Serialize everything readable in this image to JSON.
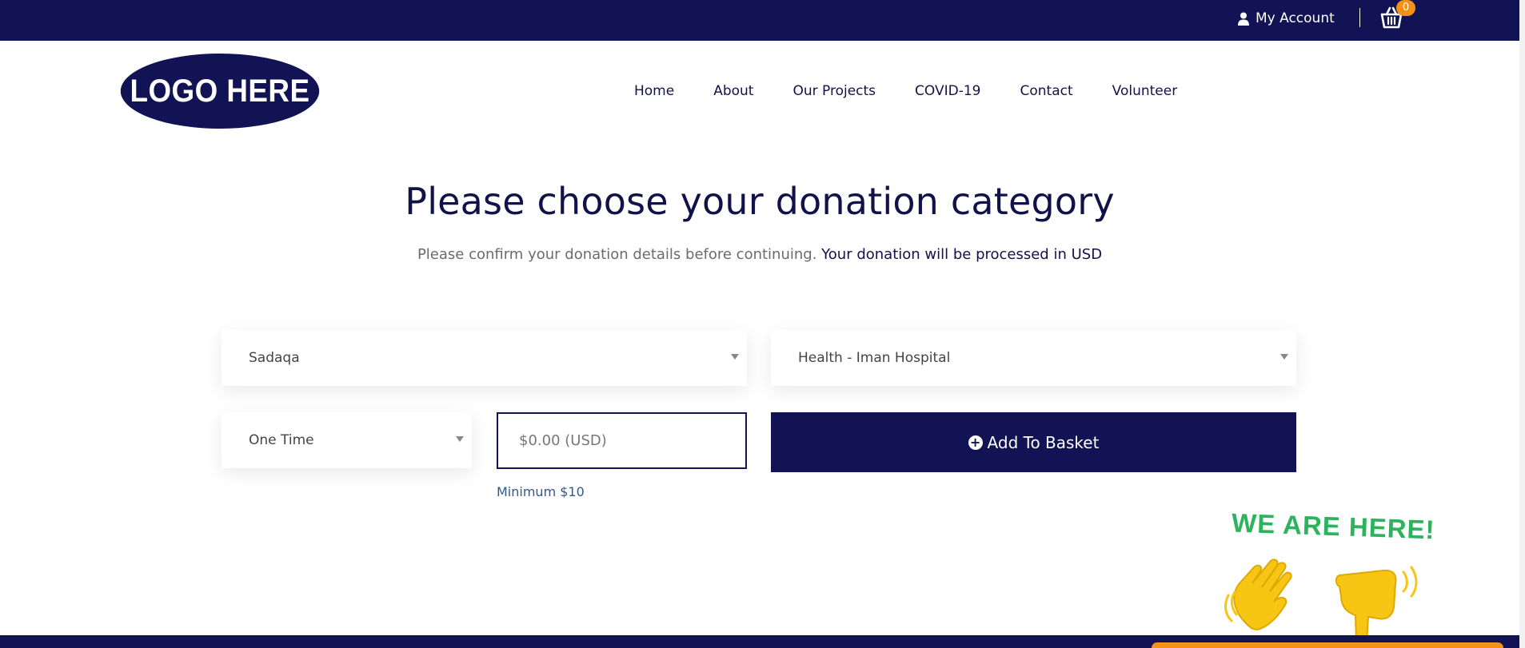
{
  "topbar": {
    "account_label": "My Account",
    "cart_count": "0"
  },
  "logo": {
    "text": "LOGO HERE"
  },
  "nav": {
    "items": [
      "Home",
      "About",
      "Our Projects",
      "COVID-19",
      "Contact",
      "Volunteer"
    ]
  },
  "main": {
    "title": "Please choose your donation category",
    "subtitle": "Please confirm your donation details before continuing.",
    "subtitle_emphasis": "Your donation will be processed in USD"
  },
  "form": {
    "category": "Sadaqa",
    "project": "Health - Iman Hospital",
    "frequency": "One Time",
    "amount_placeholder": "$0.00 (USD)",
    "minimum_note": "Minimum $10",
    "add_button_label": "Add To Basket"
  },
  "widget": {
    "text": "WE ARE HERE!"
  },
  "colors": {
    "brand_navy": "#111354",
    "accent_orange": "#f39214",
    "widget_green": "#2db35d",
    "emoji_yellow": "#f7c614"
  }
}
